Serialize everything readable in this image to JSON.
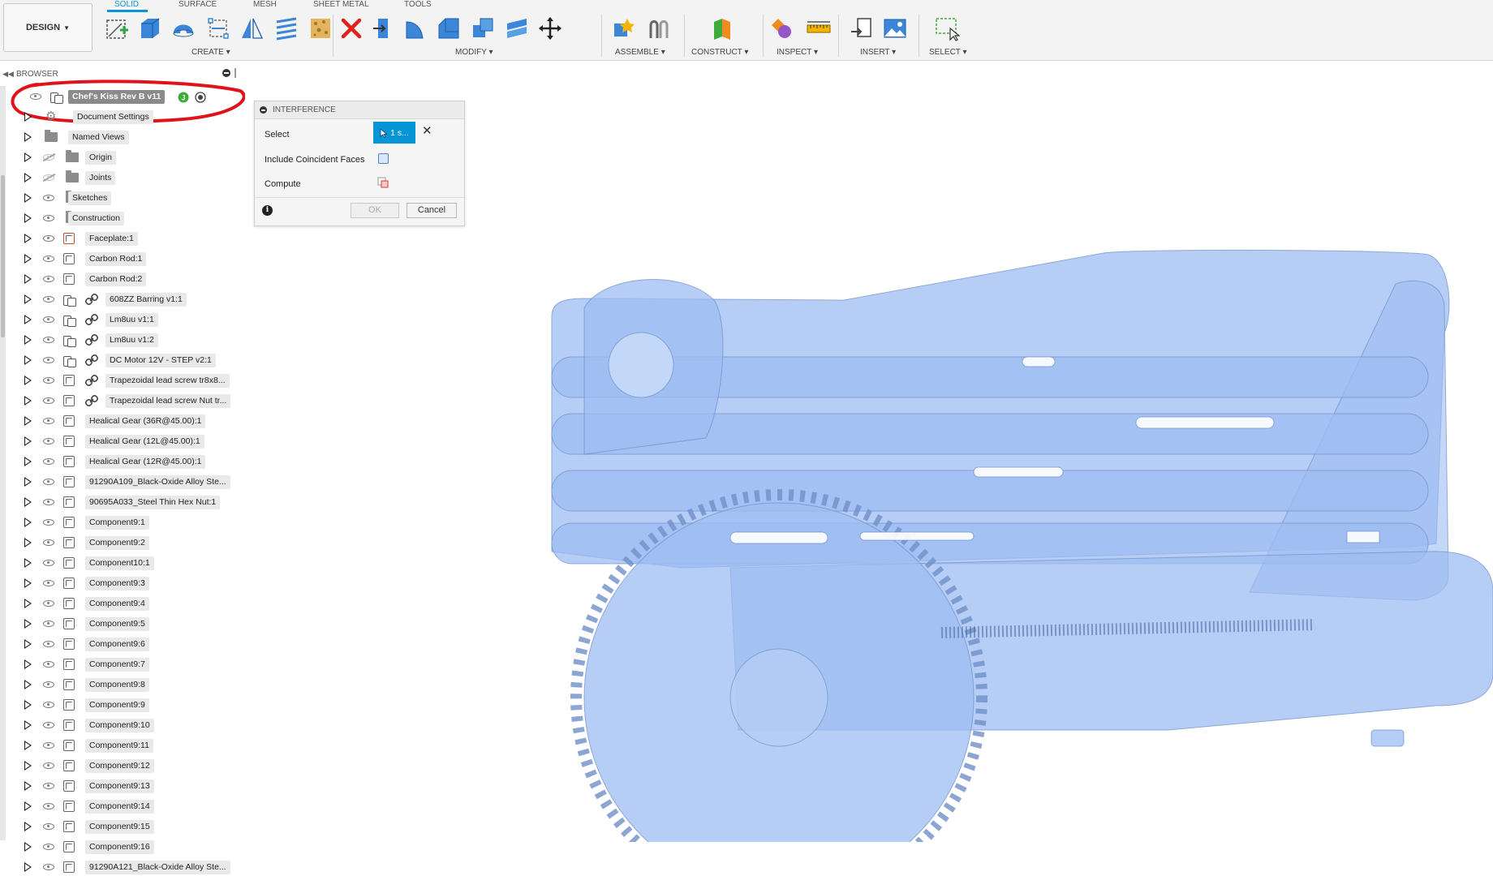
{
  "toolbar": {
    "workspace_label": "DESIGN",
    "tabs": [
      "SOLID",
      "SURFACE",
      "MESH",
      "SHEET METAL",
      "TOOLS"
    ],
    "groups": [
      "CREATE",
      "MODIFY",
      "ASSEMBLE",
      "CONSTRUCT",
      "INSPECT",
      "INSERT",
      "SELECT"
    ]
  },
  "browser": {
    "title": "BROWSER",
    "root": "Chef's Kiss Rev B v11",
    "items": [
      "Document Settings",
      "Named Views",
      "Origin",
      "Joints",
      "Sketches",
      "Construction",
      "Faceplate:1",
      "Carbon Rod:1",
      "Carbon Rod:2",
      "608ZZ Barring v1:1",
      "Lm8uu v1:1",
      "Lm8uu v1:2",
      "DC Motor 12V - STEP v2:1",
      "Trapezoidal lead screw tr8x8...",
      "Trapezoidal lead screw Nut tr...",
      "Healical Gear (36R@45.00):1",
      "Healical Gear (12L@45.00):1",
      "Healical Gear (12R@45.00):1",
      "91290A109_Black-Oxide Alloy Ste...",
      "90695A033_Steel Thin Hex Nut:1",
      "Component9:1",
      "Component9:2",
      "Component10:1",
      "Component9:3",
      "Component9:4",
      "Component9:5",
      "Component9:6",
      "Component9:7",
      "Component9:8",
      "Component9:9",
      "Component9:10",
      "Component9:11",
      "Component9:12",
      "Component9:13",
      "Component9:14",
      "Component9:15",
      "Component9:16",
      "91290A121_Black-Oxide Alloy Ste..."
    ]
  },
  "dialog": {
    "title": "INTERFERENCE",
    "select_label": "Select",
    "select_value": "1 s...",
    "coincident_label": "Include Coincident Faces",
    "compute_label": "Compute",
    "ok_label": "OK",
    "cancel_label": "Cancel"
  },
  "colors": {
    "accent": "#0696d7",
    "model_fill": "#9dbcf2",
    "annotation": "#e0131b"
  }
}
